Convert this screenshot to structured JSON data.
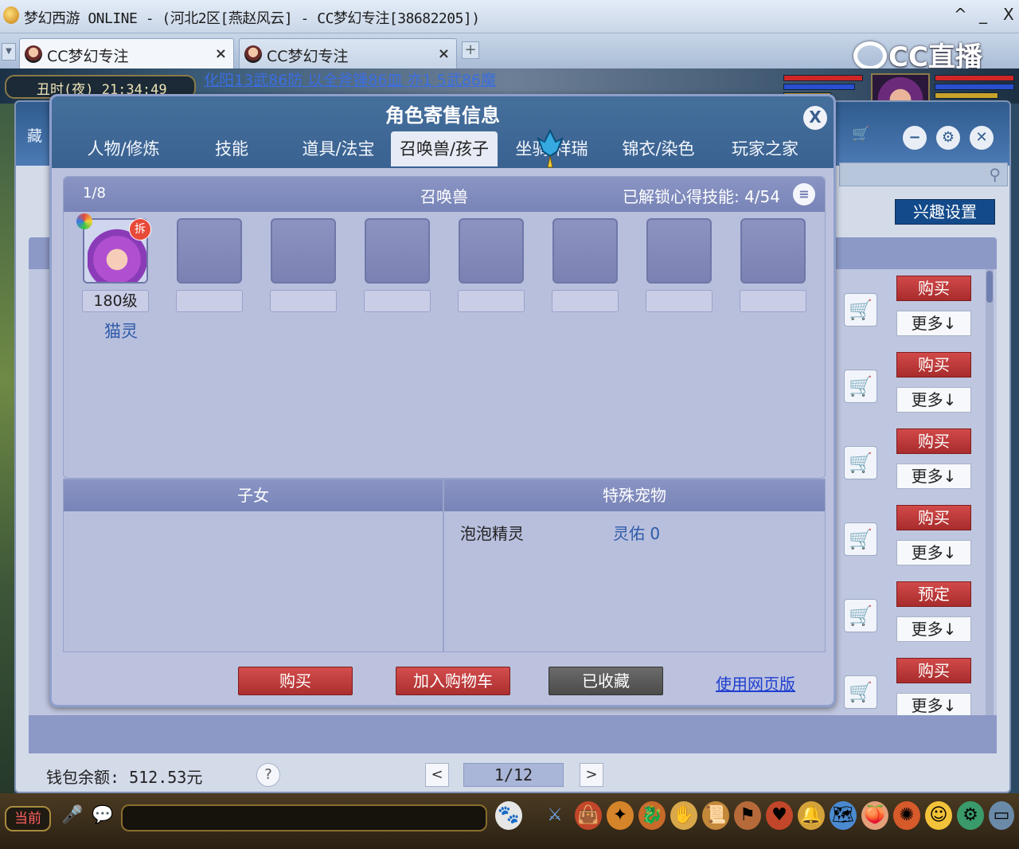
{
  "window": {
    "title": "梦幻西游 ONLINE - (河北2区[燕赵风云] - CC梦幻专注[38682205])",
    "controls": [
      "^",
      "_",
      "X"
    ]
  },
  "browser_tabs": [
    {
      "label": "CC梦幻专注",
      "active": true
    },
    {
      "label": "CC梦幻专注",
      "active": false
    }
  ],
  "tab_add": "+",
  "watermark": "CC直播",
  "game": {
    "clock": "丑时(夜) 21:34:49",
    "ticker": "化阳13武86防 以全斧锤86皿 亦1 5武86魔",
    "current_channel": "当前"
  },
  "market": {
    "side_label": "藏",
    "interest_button": "兴趣设置",
    "rows": [
      {
        "action": "购买",
        "more": "更多↓"
      },
      {
        "action": "购买",
        "more": "更多↓"
      },
      {
        "action": "购买",
        "more": "更多↓"
      },
      {
        "action": "购买",
        "more": "更多↓"
      },
      {
        "action": "预定",
        "more": "更多↓"
      },
      {
        "action": "购买",
        "more": "更多↓"
      }
    ],
    "wallet": "钱包余额: 512.53元",
    "help": "?",
    "pager": {
      "prev": "<",
      "page": "1/12",
      "next": ">"
    }
  },
  "modal": {
    "title": "角色寄售信息",
    "close": "X",
    "tabs": [
      "人物/修炼",
      "技能",
      "道具/法宝",
      "召唤兽/孩子",
      "坐骑/祥瑞",
      "锦衣/染色",
      "玩家之家"
    ],
    "active_tab": 3,
    "pets": {
      "page": "1/8",
      "title": "召唤兽",
      "skill_label": "已解锁心得技能:",
      "skill_value": "4/54",
      "first_pet": {
        "level": "180级",
        "name": "猫灵",
        "badge": "拆"
      }
    },
    "children": {
      "title": "子女"
    },
    "special": {
      "title": "特殊宠物",
      "items": [
        {
          "name": "泡泡精灵",
          "value": "灵佑 0"
        }
      ]
    },
    "buttons": {
      "buy": "购买",
      "add_cart": "加入购物车",
      "favorited": "已收藏",
      "web": "使用网页版"
    }
  }
}
